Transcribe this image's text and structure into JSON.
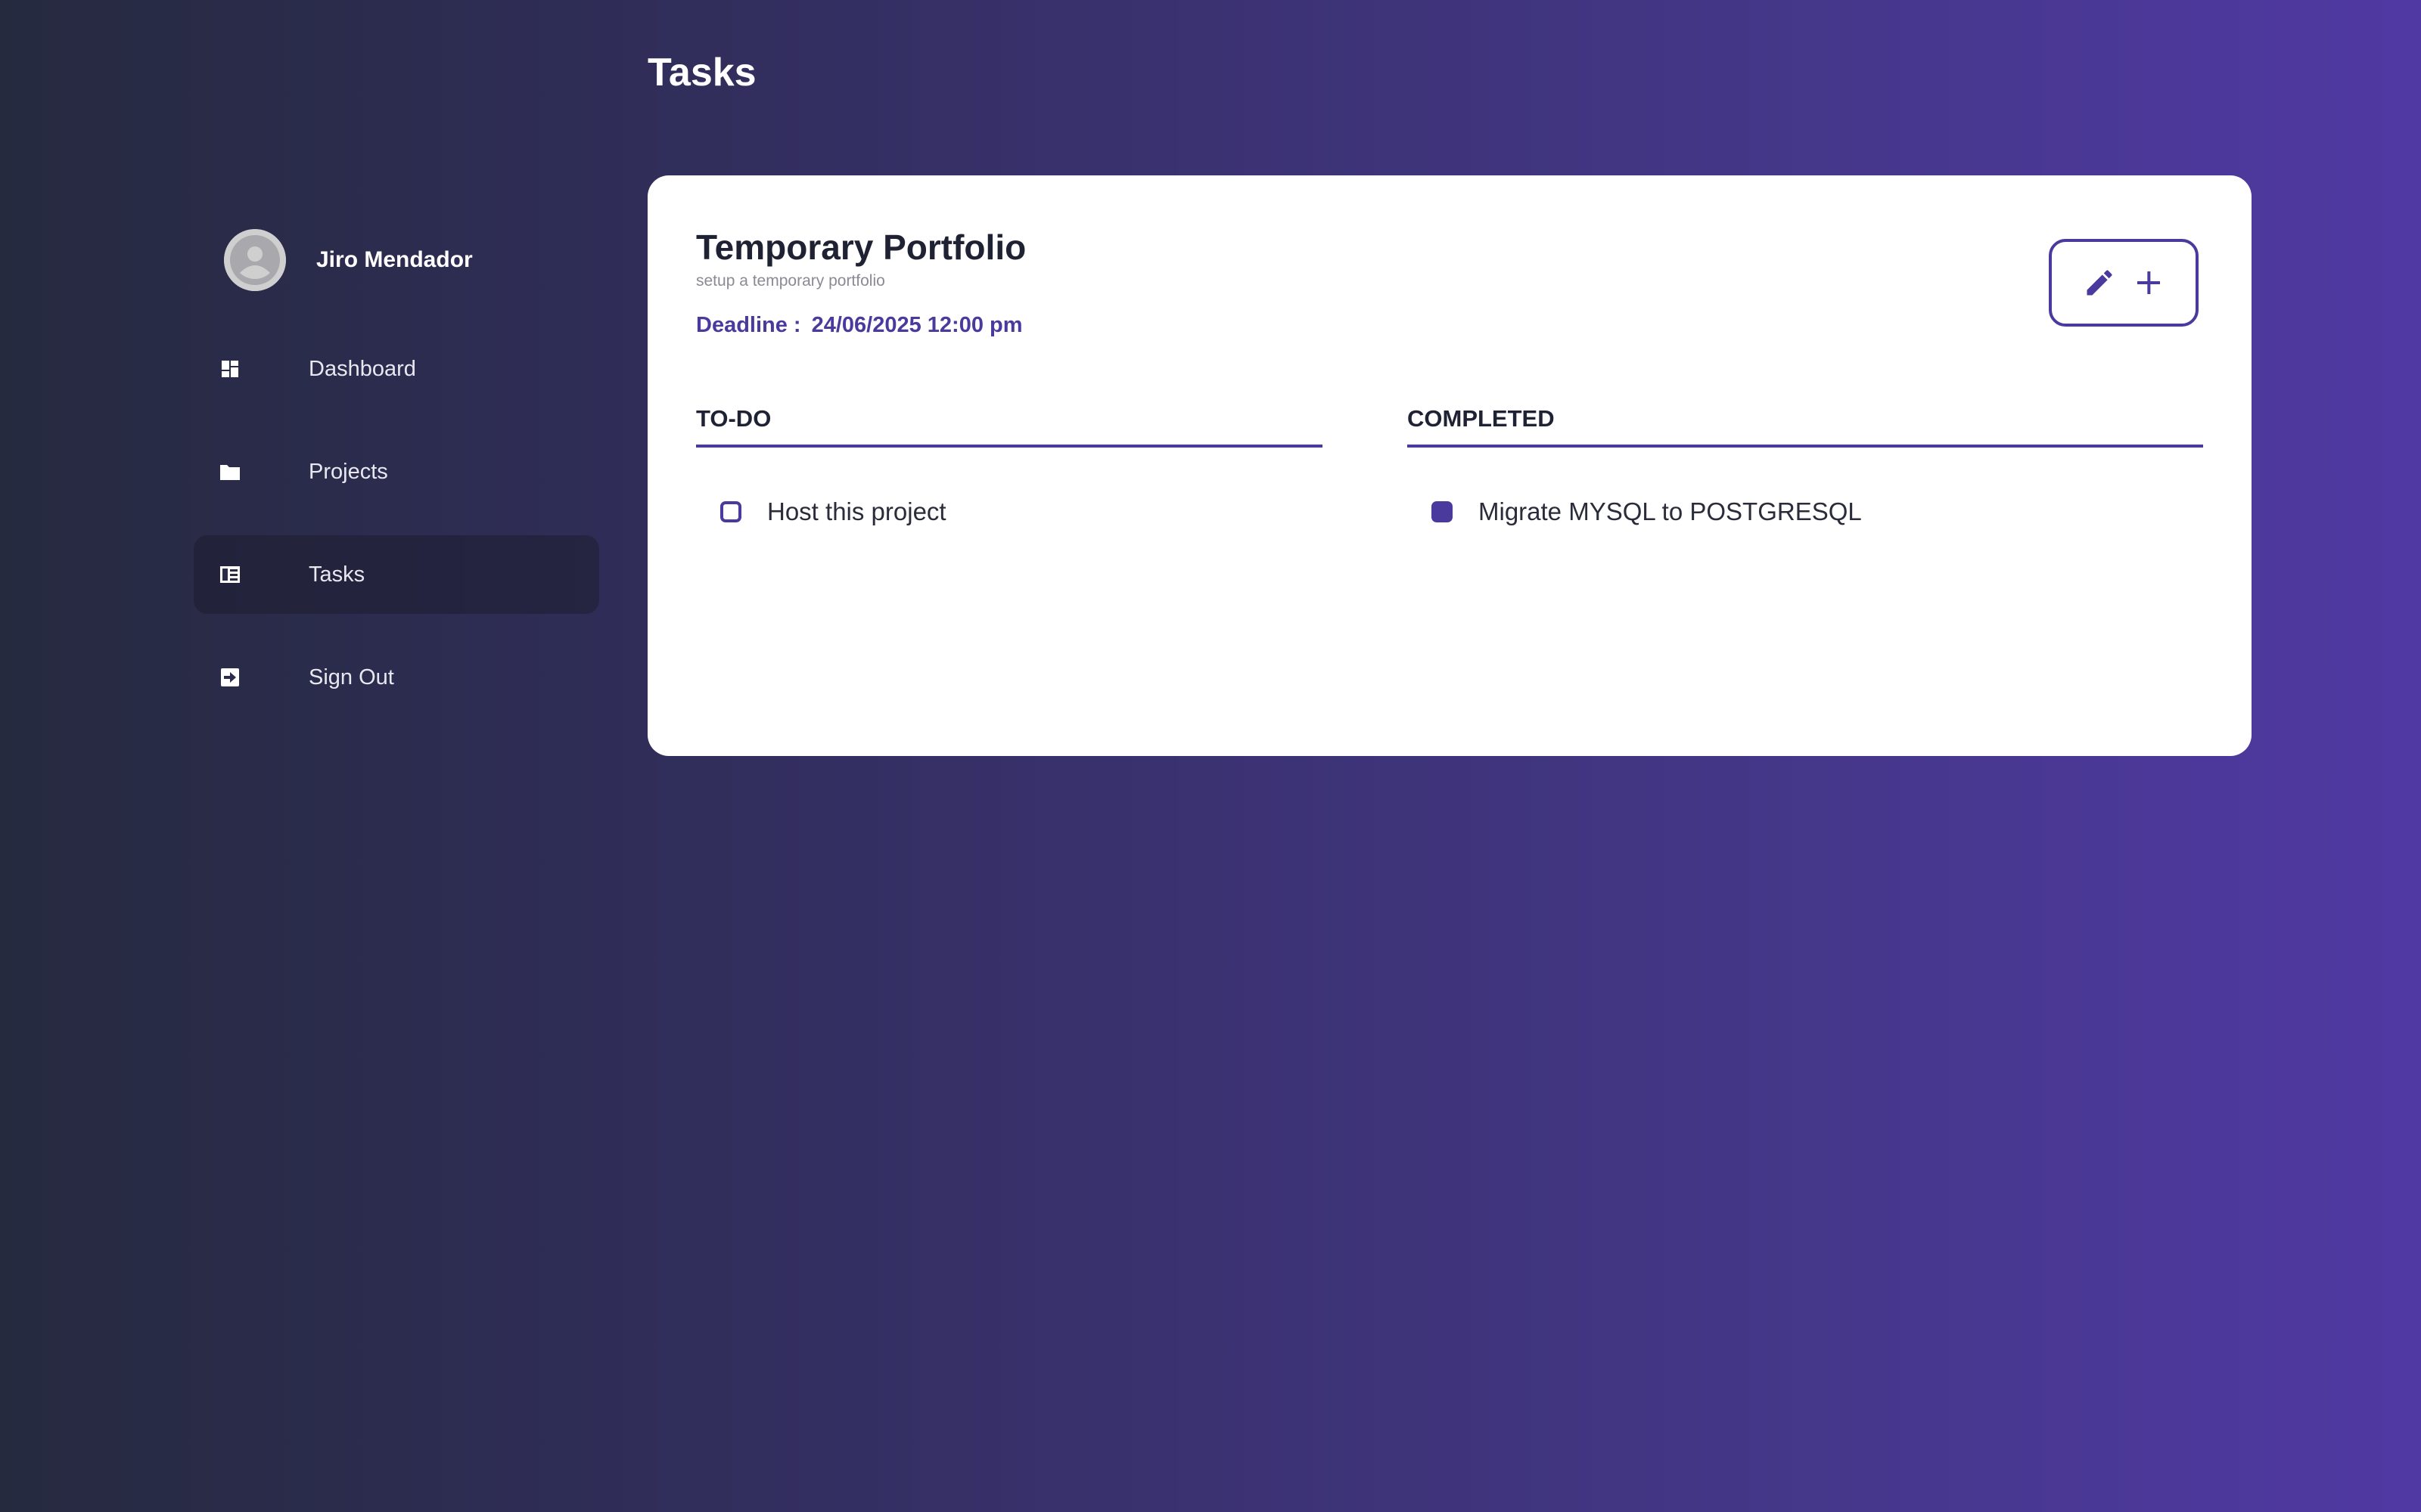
{
  "page": {
    "title": "Tasks"
  },
  "sidebar": {
    "user_name": "Jiro Mendador",
    "items": [
      {
        "label": "Dashboard",
        "icon": "dashboard-icon",
        "active": false
      },
      {
        "label": "Projects",
        "icon": "folder-icon",
        "active": false
      },
      {
        "label": "Tasks",
        "icon": "tasks-icon",
        "active": true
      },
      {
        "label": "Sign Out",
        "icon": "sign-out-icon",
        "active": false
      }
    ]
  },
  "project": {
    "title": "Temporary Portfolio",
    "description": "setup a temporary portfolio",
    "deadline_label": "Deadline :",
    "deadline_value": "24/06/2025 12:00 pm",
    "actions": [
      {
        "icon": "pencil-icon"
      },
      {
        "icon": "plus-icon"
      }
    ]
  },
  "columns": {
    "todo": {
      "header": "TO-DO",
      "tasks": [
        {
          "label": "Host this project",
          "checked": false
        }
      ]
    },
    "completed": {
      "header": "COMPLETED",
      "tasks": [
        {
          "label": "Migrate MYSQL to POSTGRESQL",
          "checked": true
        }
      ]
    }
  },
  "colors": {
    "accent": "#4b3a9e",
    "background_start": "#262a3f",
    "background_end": "#5039a3",
    "card": "#ffffff"
  }
}
